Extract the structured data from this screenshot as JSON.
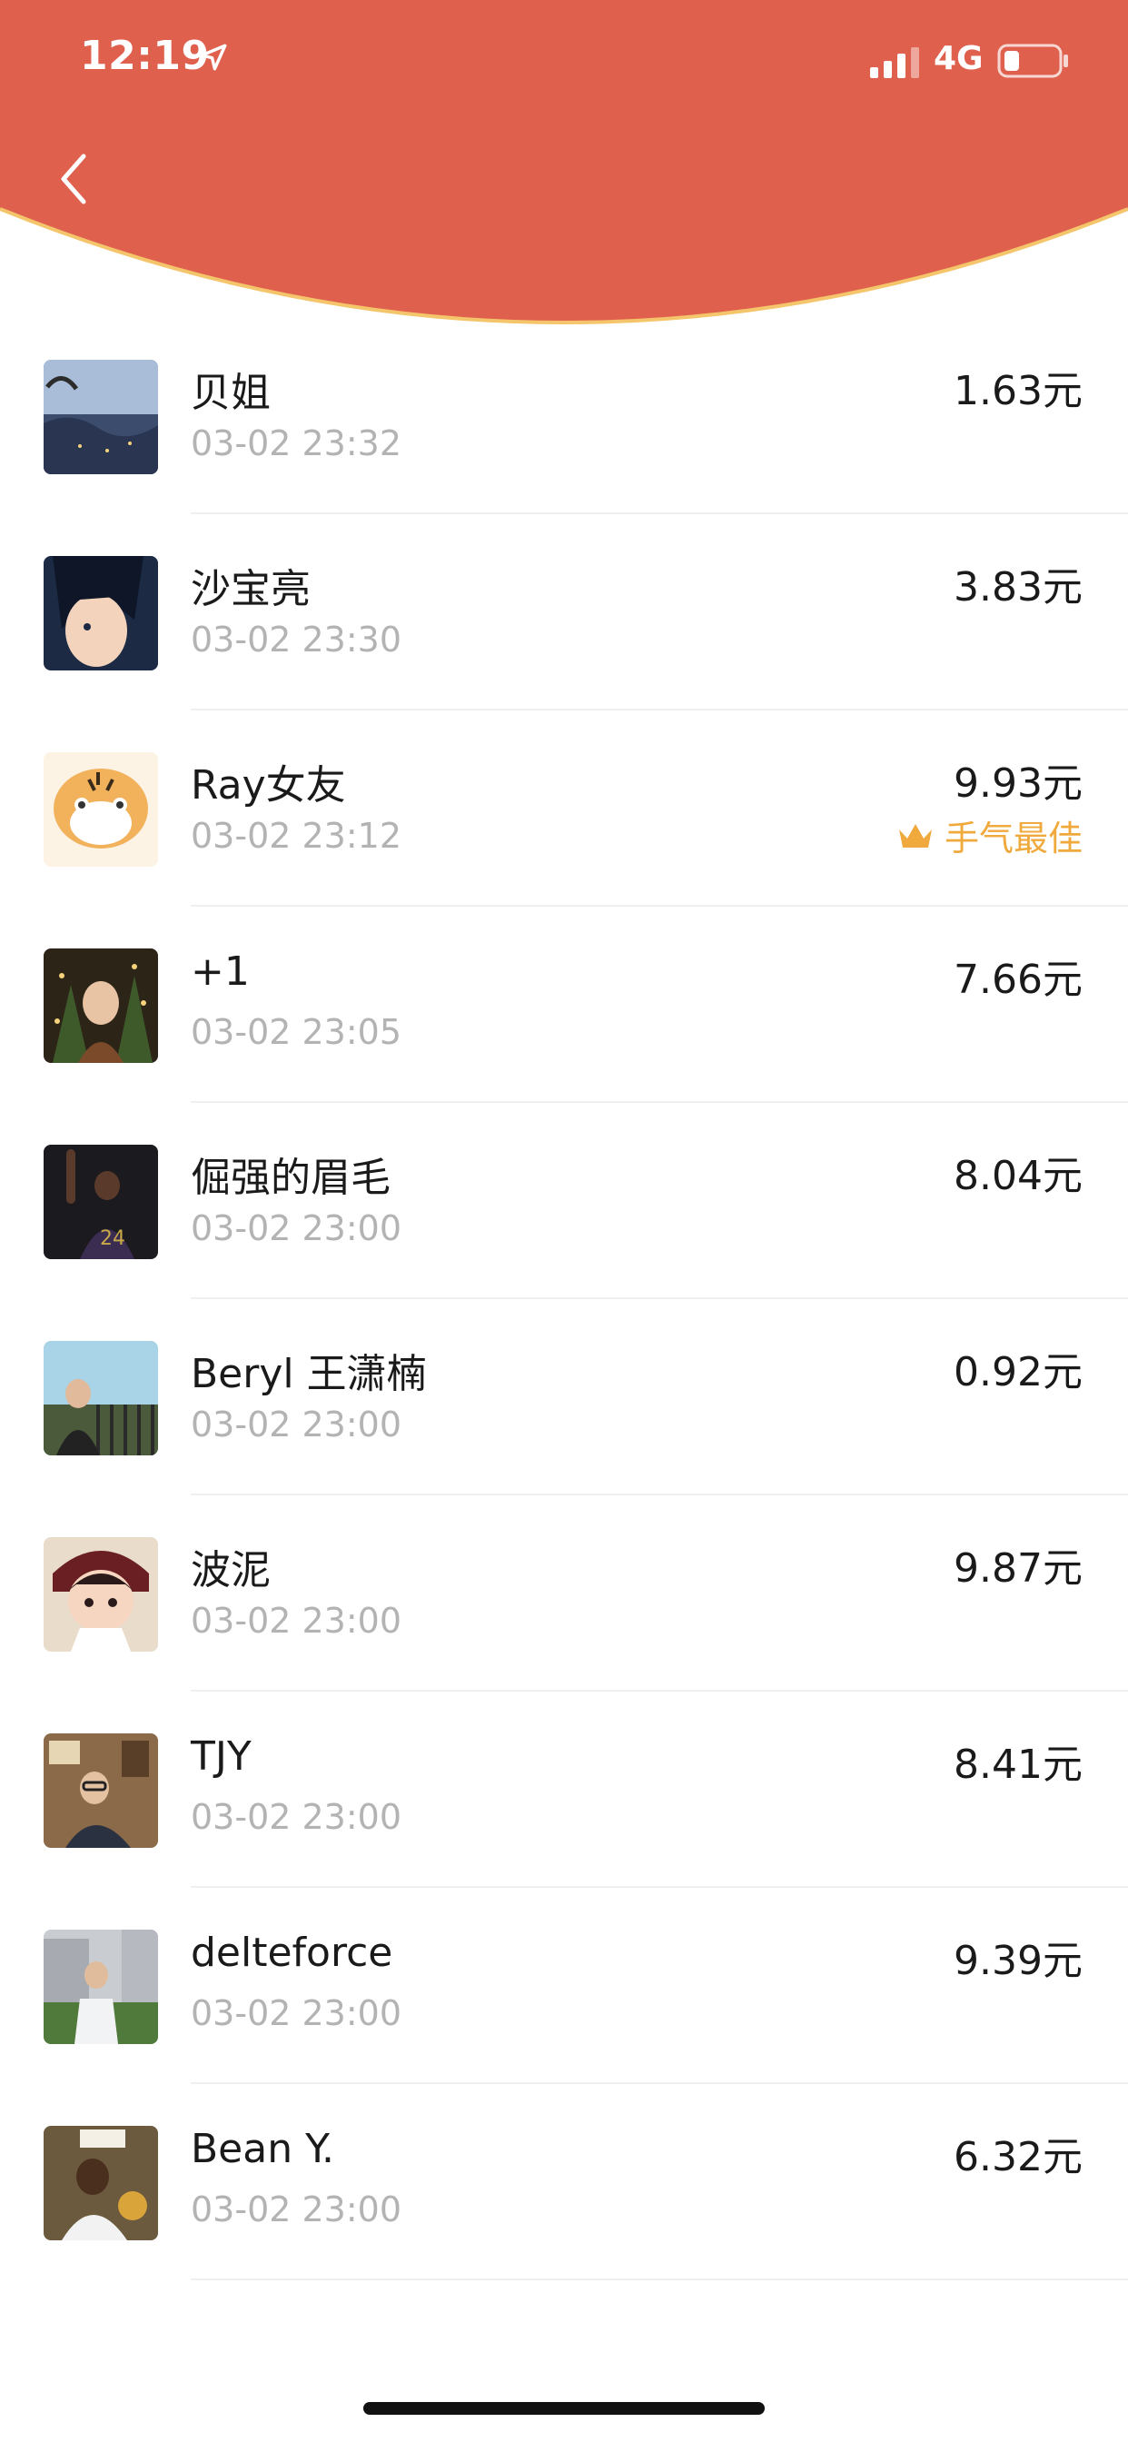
{
  "status_bar": {
    "time": "12:19",
    "network": "4G",
    "icons": [
      "location-arrow-icon",
      "cellular-signal-icon",
      "battery-icon"
    ]
  },
  "header": {
    "color": "#E0604E",
    "border_color": "#F4C56A",
    "back_icon": "chevron-left-icon"
  },
  "best_label": "手气最佳",
  "best_icon": "crown-icon",
  "best_color": "#F0A93C",
  "records": [
    {
      "name": "贝姐",
      "time": "03-02 23:32",
      "amount": "1.63元",
      "best": false
    },
    {
      "name": "沙宝亮",
      "time": "03-02 23:30",
      "amount": "3.83元",
      "best": false
    },
    {
      "name": "Ray女友",
      "time": "03-02 23:12",
      "amount": "9.93元",
      "best": true
    },
    {
      "name": "+1",
      "time": "03-02 23:05",
      "amount": "7.66元",
      "best": false
    },
    {
      "name": "倔强的眉毛",
      "time": "03-02 23:00",
      "amount": "8.04元",
      "best": false
    },
    {
      "name": "Beryl 王潇楠",
      "time": "03-02 23:00",
      "amount": "0.92元",
      "best": false
    },
    {
      "name": "波泥",
      "time": "03-02 23:00",
      "amount": "9.87元",
      "best": false
    },
    {
      "name": "TJY",
      "time": "03-02 23:00",
      "amount": "8.41元",
      "best": false
    },
    {
      "name": "delteforce",
      "time": "03-02 23:00",
      "amount": "9.39元",
      "best": false
    },
    {
      "name": "Bean Y.",
      "time": "03-02 23:00",
      "amount": "6.32元",
      "best": false
    }
  ]
}
